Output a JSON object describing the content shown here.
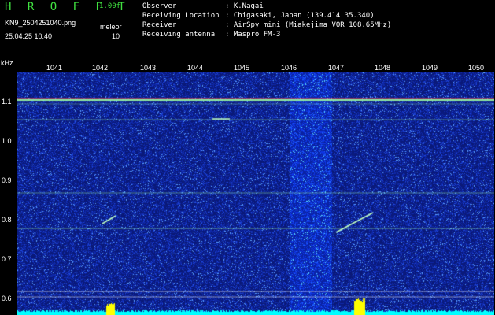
{
  "header": {
    "title": "H R O F F T",
    "version": "1.00f",
    "filename": "KN9_2504251040.png",
    "mode": "meleor",
    "datetime": "25.04.25 10:40",
    "mode_value": "10"
  },
  "info": {
    "observer_label": "Observer",
    "observer_value": ": K.Nagai",
    "location_label": "Receiving Location",
    "location_value": ": Chigasaki, Japan (139.414 35.340)",
    "receiver_label": "Receiver",
    "receiver_value": ": AirSpy mini (Miakejima VOR 108.65MHz)",
    "antenna_label": "Receiving antenna",
    "antenna_value": ": Maspro FM-3"
  },
  "axes": {
    "unit": "kHz",
    "x_ticks": [
      "1041",
      "1042",
      "1043",
      "1044",
      "1045",
      "1046",
      "1047",
      "1048",
      "1049",
      "1050"
    ],
    "y_ticks": [
      "1.1",
      "1.0",
      "0.9",
      "0.8",
      "0.7",
      "0.6"
    ]
  },
  "colors": {
    "background": "#000000",
    "noise_base": "#0a1a7a",
    "carrier_line": "#a0ffa0",
    "carrier_red": "#ff4040",
    "meteor_trace": "#c0ffc0",
    "bottom_band": "#00ffff",
    "bottom_spike": "#ffff00"
  }
}
